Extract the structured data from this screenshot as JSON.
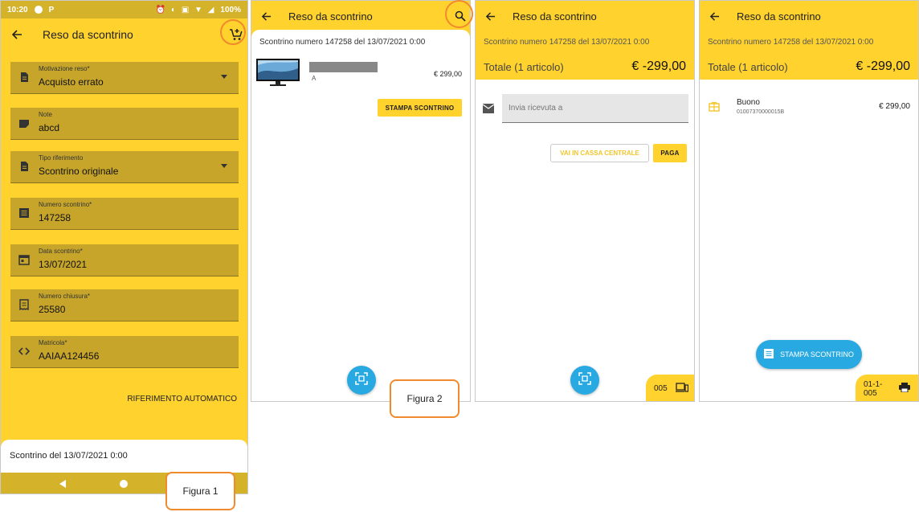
{
  "colors": {
    "primary_yellow": "#FFD22E",
    "field_yellow": "#C6A52A",
    "status_bar": "#D4B22A",
    "fab_blue": "#29A9E1",
    "callout_orange": "#F08A2C"
  },
  "screen1": {
    "status_bar": {
      "time": "10:20",
      "app_letter": "P",
      "battery": "100%"
    },
    "toolbar": {
      "title": "Reso da scontrino",
      "back_icon": "arrow-left-icon",
      "action_icon": "cart-add-icon"
    },
    "fields": [
      {
        "label": "Motivazione reso*",
        "value": "Acquisto errato",
        "icon": "document-icon",
        "dropdown": true
      },
      {
        "label": "Note",
        "value": "abcd",
        "icon": "note-icon",
        "dropdown": false
      },
      {
        "label": "Tipo riferimento",
        "value": "Scontrino originale",
        "icon": "document-icon",
        "dropdown": true
      },
      {
        "label": "Numero scontrino*",
        "value": "147258",
        "icon": "list-icon",
        "dropdown": false
      },
      {
        "label": "Data scontrino*",
        "value": "13/07/2021",
        "icon": "calendar-icon",
        "dropdown": false
      },
      {
        "label": "Numero chiusura*",
        "value": "25580",
        "icon": "receipt-icon",
        "dropdown": false
      },
      {
        "label": "Matricola*",
        "value": "AAIAA124456",
        "icon": "code-icon",
        "dropdown": false
      }
    ],
    "auto_reference": "RIFERIMENTO AUTOMATICO",
    "bottom_card": "Scontrino del 13/07/2021 0:00"
  },
  "screen2": {
    "toolbar": {
      "title": "Reso da scontrino",
      "action_icon": "search-icon"
    },
    "receipt_title": "Scontrino numero 147258 del 13/07/2021 0:00",
    "product": {
      "code": "A",
      "price": "€ 299,00",
      "image_icon": "monitor-image"
    },
    "print_button": "STAMPA SCONTRINO",
    "fab_icon": "barcode-scan-icon"
  },
  "screen3": {
    "toolbar": {
      "title": "Reso da scontrino"
    },
    "receipt_title": "Scontrino numero 147258 del 13/07/2021 0:00",
    "total_label": "Totale (1 articolo)",
    "total_value": "€ -299,00",
    "send_placeholder": "Invia ricevuta a",
    "central_button": "VAI IN CASSA CENTRALE",
    "pay_button": "PAGA",
    "corner": {
      "text": "005",
      "icon": "devices-icon"
    },
    "fab_icon": "barcode-scan-icon"
  },
  "screen4": {
    "toolbar": {
      "title": "Reso da scontrino"
    },
    "receipt_title": "Scontrino numero 147258 del 13/07/2021 0:00",
    "total_label": "Totale (1 articolo)",
    "total_value": "€ -299,00",
    "item": {
      "name": "Buono",
      "code": "01007370000015B",
      "price": "€ 299,00",
      "icon": "gift-card-icon"
    },
    "print_button": "STAMPA SCONTRINO",
    "corner": {
      "text": "01-1-005",
      "icon": "printer-icon"
    }
  },
  "callouts": {
    "figure1": "Figura 1",
    "figure2": "Figura 2"
  }
}
